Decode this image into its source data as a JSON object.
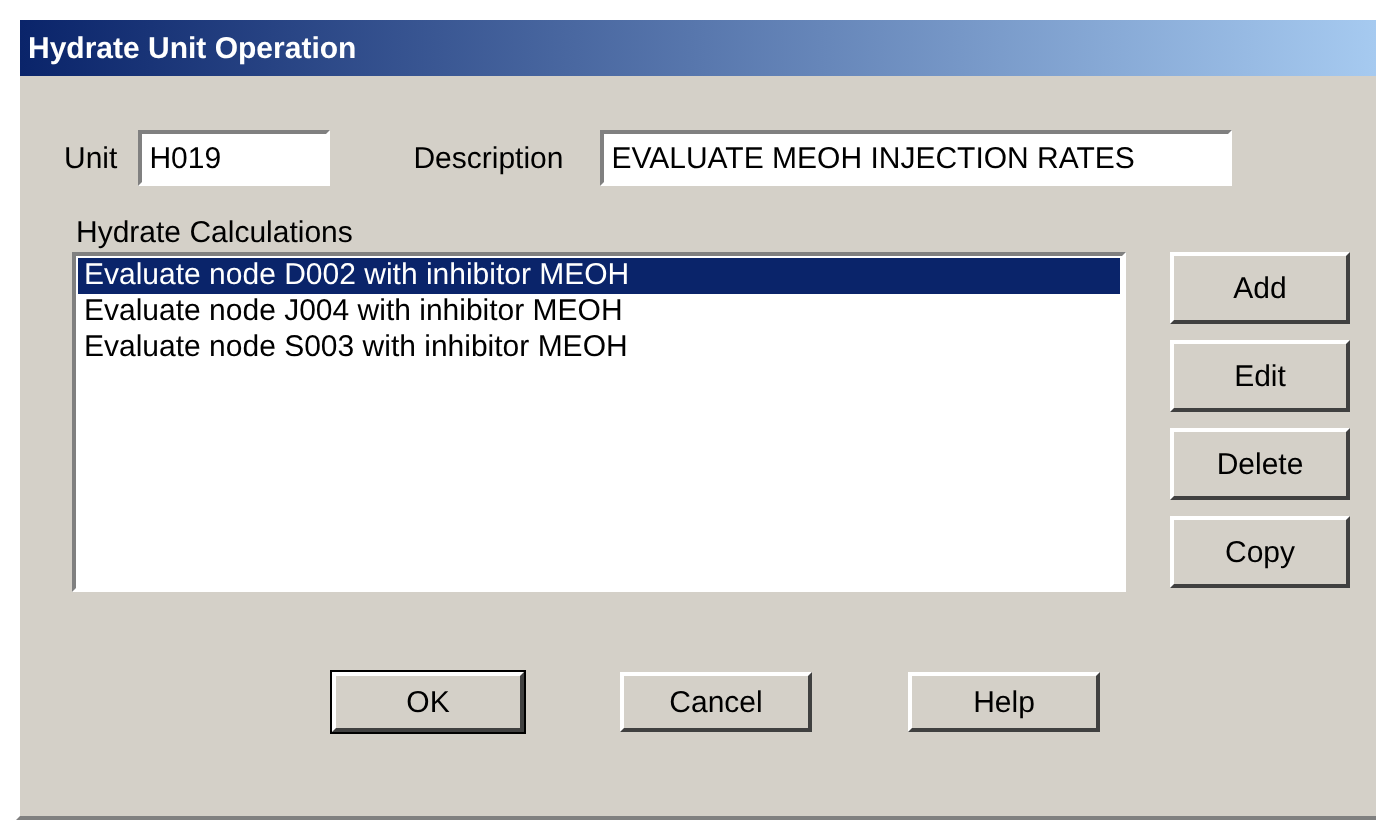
{
  "window": {
    "title": "Hydrate Unit Operation"
  },
  "unit": {
    "label": "Unit",
    "value": "H019"
  },
  "description": {
    "label": "Description",
    "value": "EVALUATE MEOH INJECTION RATES"
  },
  "calculations": {
    "label": "Hydrate Calculations",
    "items": [
      {
        "text": "Evaluate node D002 with inhibitor MEOH",
        "selected": true
      },
      {
        "text": "Evaluate node J004 with inhibitor MEOH",
        "selected": false
      },
      {
        "text": "Evaluate node S003 with inhibitor MEOH",
        "selected": false
      }
    ]
  },
  "side_buttons": [
    "Add",
    "Edit",
    "Delete",
    "Copy"
  ],
  "buttons": [
    {
      "label": "OK",
      "default": true
    },
    {
      "label": "Cancel",
      "default": false
    },
    {
      "label": "Help",
      "default": false
    }
  ]
}
